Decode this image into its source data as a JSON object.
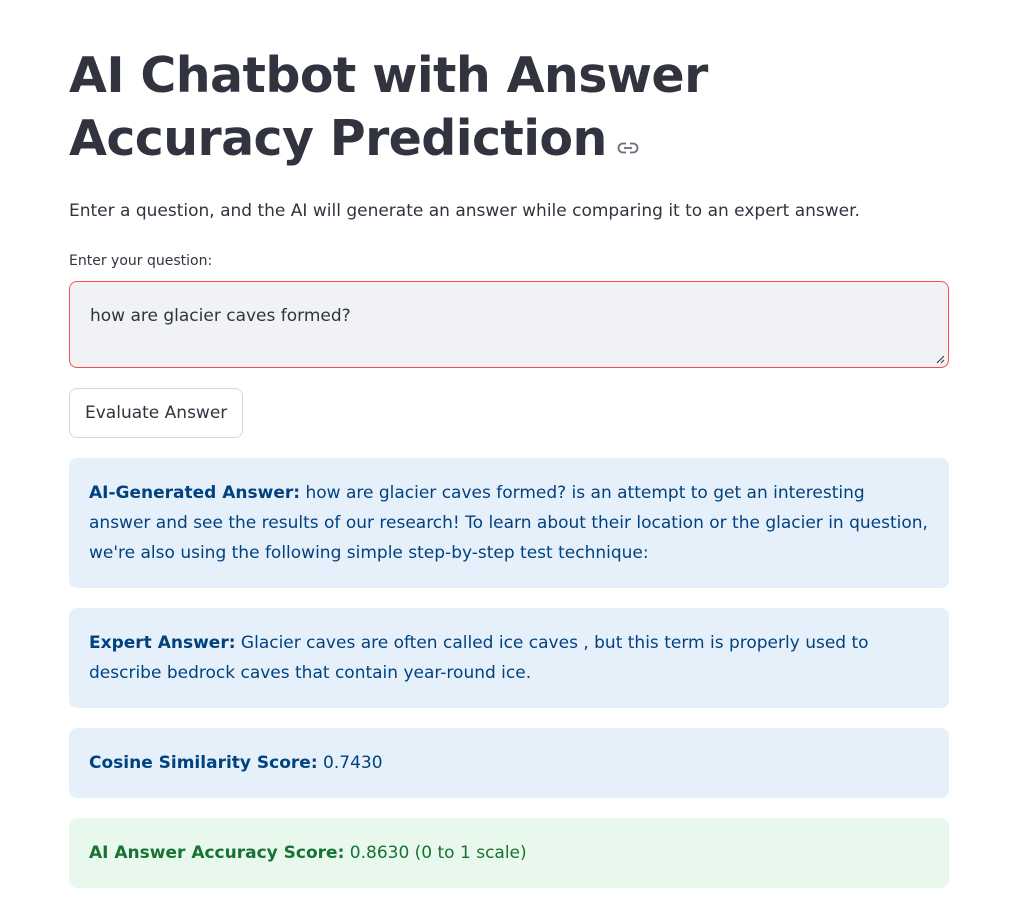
{
  "page": {
    "title": "AI Chatbot with Answer Accuracy Prediction",
    "intro": "Enter a question, and the AI will generate an answer while comparing it to an expert answer."
  },
  "form": {
    "question_label": "Enter your question:",
    "question_value": "how are glacier caves formed?",
    "submit_label": "Evaluate Answer"
  },
  "results": {
    "ai_answer_label": "AI-Generated Answer:",
    "ai_answer_text": " how are glacier caves formed? is an attempt to get an interesting answer and see the results of our research! To learn about their location or the glacier in question, we're also using the following simple step-by-step test technique:",
    "expert_answer_label": "Expert Answer:",
    "expert_answer_text": " Glacier caves are often called ice caves , but this term is properly used to describe bedrock caves that contain year-round ice.",
    "cosine_label": "Cosine Similarity Score:",
    "cosine_value": " 0.7430",
    "accuracy_label": "AI Answer Accuracy Score:",
    "accuracy_value": " 0.8630 (0 to 1 scale)"
  },
  "colors": {
    "text": "#31333f",
    "error_border": "#ff4b4b",
    "input_bg": "#f0f2f6",
    "info_bg": "#e6f0fb",
    "info_text": "#004280",
    "success_bg": "#e8f8ec",
    "success_text": "#177233"
  },
  "icons": {
    "title_anchor": "link-icon",
    "textarea_resize": "resize-handle-icon"
  }
}
